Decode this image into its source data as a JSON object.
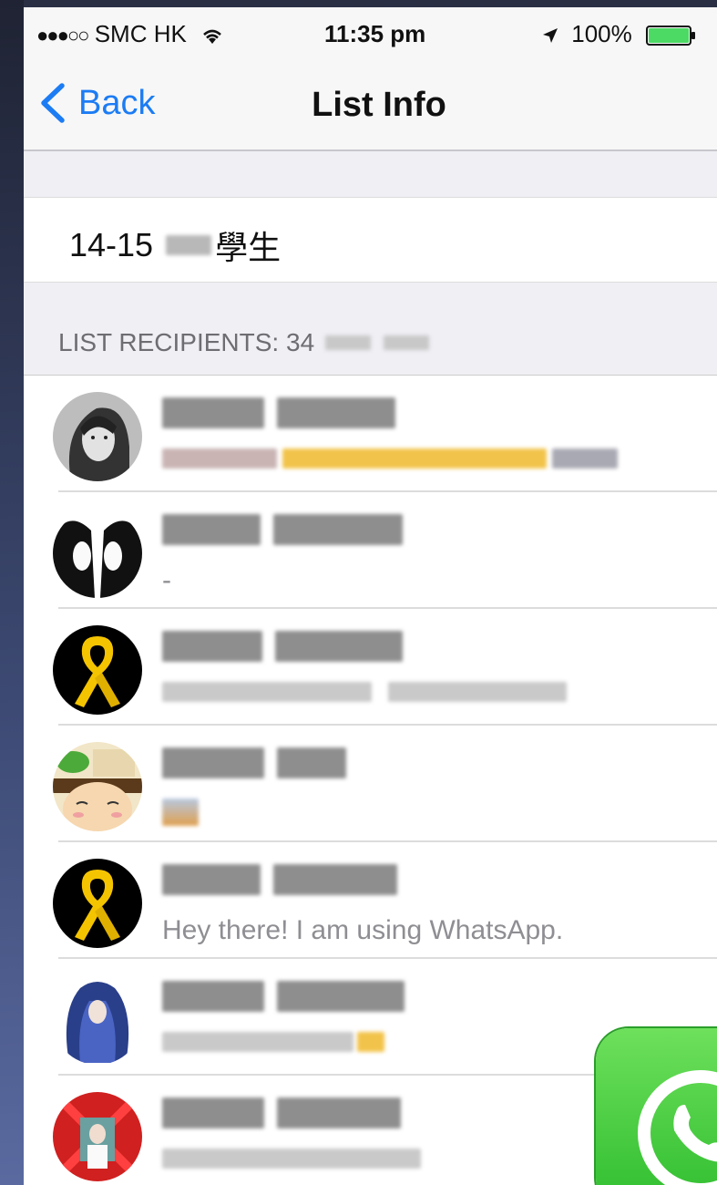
{
  "status_bar": {
    "carrier": "SMC HK",
    "signal_dots": "●●●○○",
    "time": "11:35 pm",
    "battery": "100%"
  },
  "nav": {
    "back_label": "Back",
    "title": "List Info"
  },
  "list_name": {
    "prefix": "14-15",
    "suffix": "學生"
  },
  "section": {
    "header": "LIST RECIPIENTS: 34"
  },
  "recipients": [
    {
      "avatar": "grayscale-portrait-avatar",
      "status": ""
    },
    {
      "avatar": "silhouette-faces-avatar",
      "status": "-"
    },
    {
      "avatar": "yellow-ribbon-avatar",
      "status": ""
    },
    {
      "avatar": "cartoon-character-avatar",
      "status": ""
    },
    {
      "avatar": "yellow-ribbon-avatar",
      "status": "Hey there! I am using WhatsApp."
    },
    {
      "avatar": "blue-hair-avatar",
      "status": ""
    },
    {
      "avatar": "red-photo-avatar",
      "status": ""
    }
  ],
  "colors": {
    "ios_blue": "#1c7cf4",
    "whatsapp_green": "#2fbd2f",
    "ribbon_yellow": "#f5c400"
  }
}
